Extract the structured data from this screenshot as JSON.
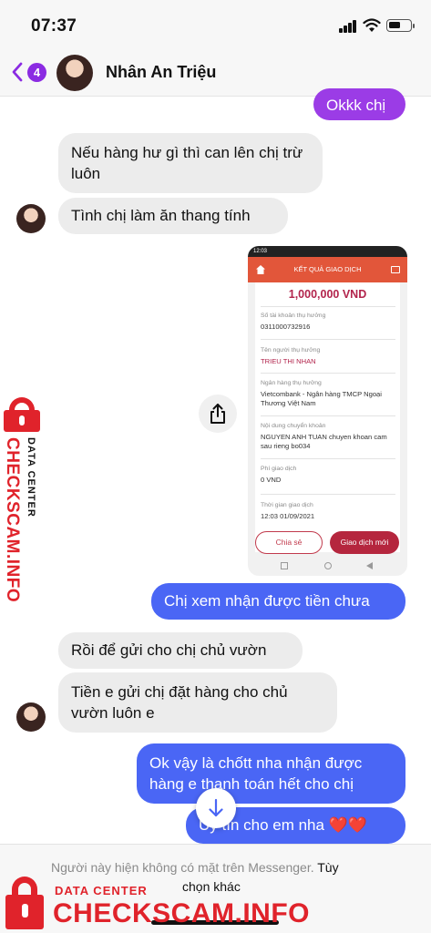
{
  "status_bar": {
    "time": "07:37"
  },
  "header": {
    "back_badge": "4",
    "contact_name": "Nhân An Triệu"
  },
  "messages": {
    "m0": "Okkk chị",
    "m1": "Nếu hàng hư gì thì can lên chị trừ luôn",
    "m2": "Tình chị làm ăn thang tính",
    "m3": "Chị xem nhận được tiền chưa",
    "m4": "Rồi để gửi cho chị chủ vườn",
    "m5": "Tiền e gửi chị đặt hàng cho chủ vườn luôn e",
    "m6": "Ok vậy là chốtt nha nhận được hàng e thanh toán hết cho chị",
    "m7": "Uy tín cho em nha ❤️❤️"
  },
  "receipt": {
    "status_time": "12:03",
    "title": "KẾT QUẢ GIAO DỊCH",
    "amount": "1,000,000 VND",
    "account_label": "Số tài khoản thụ hưởng",
    "account_value": "0311000732916",
    "name_label": "Tên người thụ hưởng",
    "name_value": "TRIEU THI NHAN",
    "bank_label": "Ngân hàng thụ hưởng",
    "bank_value": "Vietcombank - Ngân hàng TMCP Ngoại Thương Việt Nam",
    "content_label": "Nội dung chuyển khoản",
    "content_value": "NGUYEN ANH TUAN chuyen khoan cam sau rieng bo034",
    "fee_label": "Phí giao dịch",
    "fee_value": "0 VND",
    "time_label": "Thời gian giao dịch",
    "time_value": "12:03 01/09/2021",
    "share_button": "Chia sẻ",
    "new_button": "Giao dịch mới"
  },
  "footer": {
    "notice": "Người này hiện không có mặt trên Messenger.",
    "action_1": "Tùy",
    "action_2": "chọn khác"
  },
  "watermark": {
    "data_center": "DATA CENTER",
    "site": "CHECKSCAM.INFO",
    "color": "#e0232b"
  },
  "colors": {
    "outgoing_bubble": "#4a66f5",
    "accent_purple": "#9b3ce6",
    "incoming_bubble": "#ececec"
  },
  "icons": [
    "back-chevron-icon",
    "share-icon",
    "arrow-down-icon",
    "lock-icon",
    "wifi-icon",
    "signal-icon",
    "battery-icon",
    "home-icon"
  ]
}
